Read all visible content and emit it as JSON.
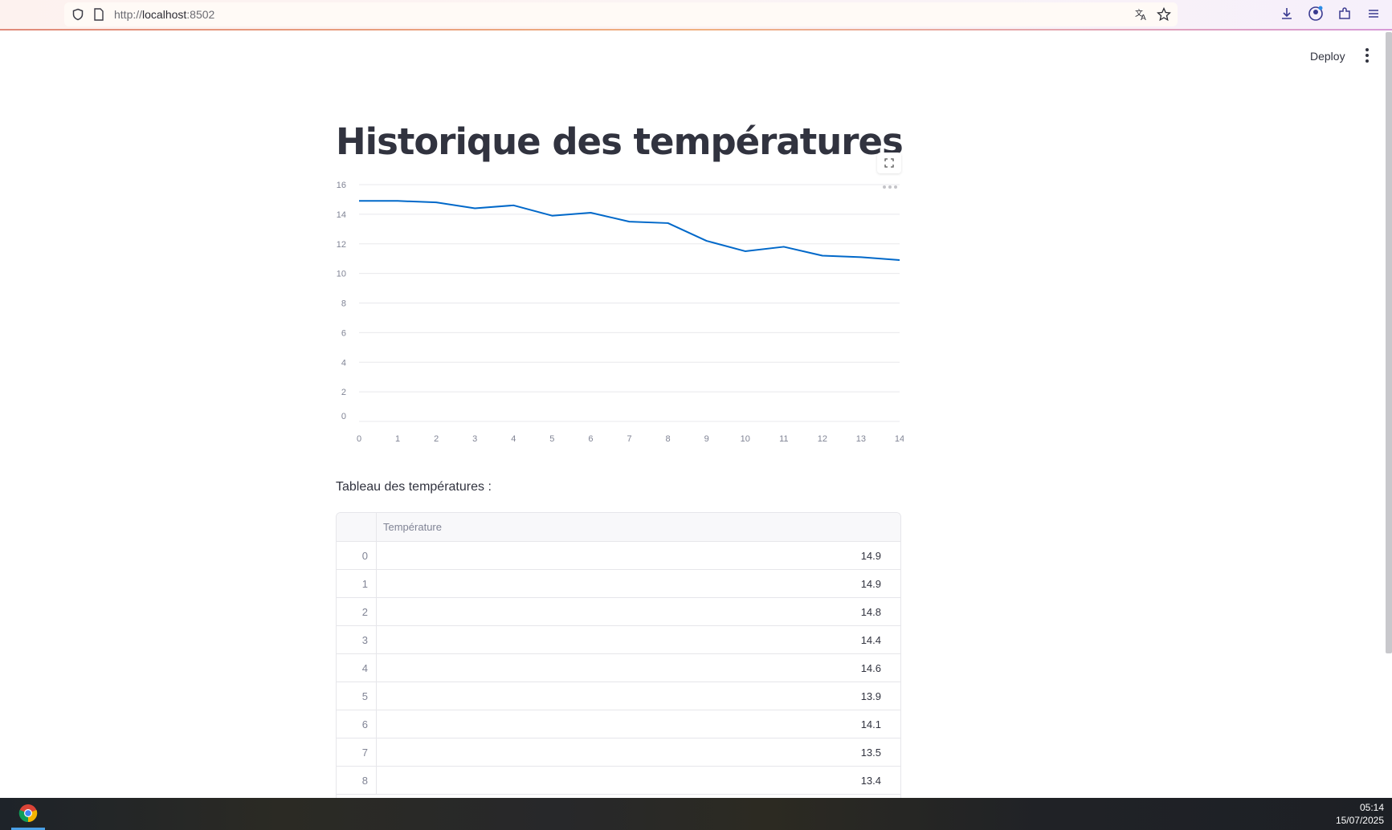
{
  "browser": {
    "url_prefix": "http://",
    "url_host": "localhost",
    "url_port": ":8502"
  },
  "header": {
    "deploy_label": "Deploy"
  },
  "page": {
    "title": "Historique des températures",
    "table_caption": "Tableau des températures :"
  },
  "chart_data": {
    "type": "line",
    "x": [
      0,
      1,
      2,
      3,
      4,
      5,
      6,
      7,
      8,
      9,
      10,
      11,
      12,
      13,
      14
    ],
    "series": [
      {
        "values": [
          14.9,
          14.9,
          14.8,
          14.4,
          14.6,
          13.9,
          14.1,
          13.5,
          13.4,
          12.2,
          11.5,
          11.8,
          11.2,
          11.1,
          10.9
        ]
      }
    ],
    "xlim": [
      0,
      14
    ],
    "ylim": [
      0,
      16
    ],
    "y_ticks": [
      0,
      2,
      4,
      6,
      8,
      10,
      12,
      14,
      16
    ],
    "x_ticks": [
      0,
      1,
      2,
      3,
      4,
      5,
      6,
      7,
      8,
      9,
      10,
      11,
      12,
      13,
      14
    ],
    "grid": true,
    "color": "#0068c9"
  },
  "table": {
    "column_header": "Température",
    "rows": [
      {
        "index": "0",
        "value": "14.9"
      },
      {
        "index": "1",
        "value": "14.9"
      },
      {
        "index": "2",
        "value": "14.8"
      },
      {
        "index": "3",
        "value": "14.4"
      },
      {
        "index": "4",
        "value": "14.6"
      },
      {
        "index": "5",
        "value": "13.9"
      },
      {
        "index": "6",
        "value": "14.1"
      },
      {
        "index": "7",
        "value": "13.5"
      },
      {
        "index": "8",
        "value": "13.4"
      }
    ]
  },
  "taskbar": {
    "time": "05:14",
    "date": "15/07/2025"
  }
}
